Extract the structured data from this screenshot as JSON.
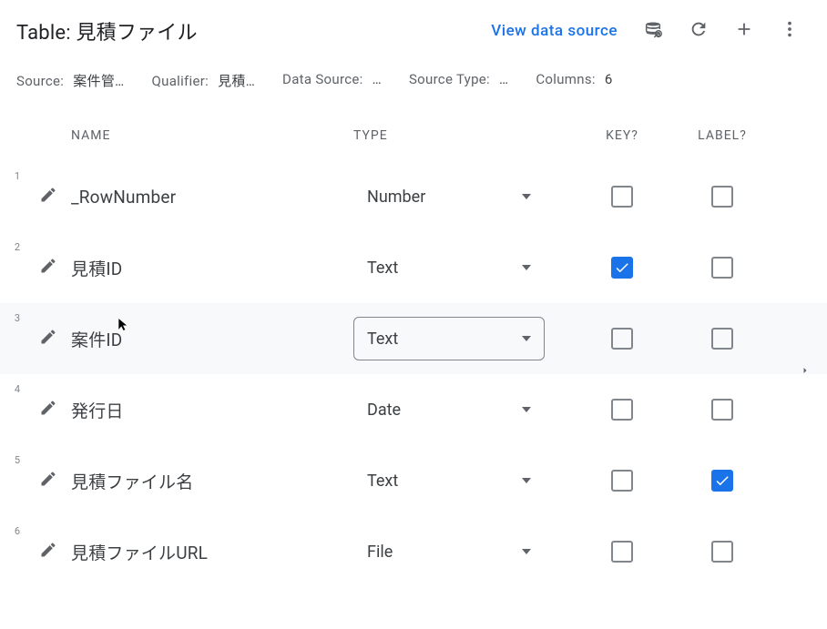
{
  "header": {
    "title_prefix": "Table:",
    "title_value": "見積ファイル",
    "view_link": "View data source"
  },
  "info": {
    "source_label": "Source:",
    "source_value": "案件管…",
    "qualifier_label": "Qualifier:",
    "qualifier_value": "見積…",
    "datasource_label": "Data Source:",
    "datasource_value": "…",
    "sourcetype_label": "Source Type:",
    "sourcetype_value": "…",
    "columns_label": "Columns:",
    "columns_value": "6"
  },
  "tableHeaders": {
    "name": "NAME",
    "type": "TYPE",
    "key": "KEY?",
    "label": "LABEL?"
  },
  "rows": [
    {
      "idx": "1",
      "name": "_RowNumber",
      "type": "Number",
      "key": false,
      "label": false,
      "active": false
    },
    {
      "idx": "2",
      "name": "見積ID",
      "type": "Text",
      "key": true,
      "label": false,
      "active": false
    },
    {
      "idx": "3",
      "name": "案件ID",
      "type": "Text",
      "key": false,
      "label": false,
      "active": true
    },
    {
      "idx": "4",
      "name": "発行日",
      "type": "Date",
      "key": false,
      "label": false,
      "active": false
    },
    {
      "idx": "5",
      "name": "見積ファイル名",
      "type": "Text",
      "key": false,
      "label": true,
      "active": false
    },
    {
      "idx": "6",
      "name": "見積ファイルURL",
      "type": "File",
      "key": false,
      "label": false,
      "active": false
    }
  ],
  "icons": {
    "regenerate": "regenerate-icon",
    "refresh": "refresh-icon",
    "add": "plus-icon",
    "menu": "more-vert-icon",
    "edit": "pencil-icon",
    "dropdown": "chevron-down-icon",
    "check": "check-icon",
    "expand": "chevron-right-icon"
  }
}
